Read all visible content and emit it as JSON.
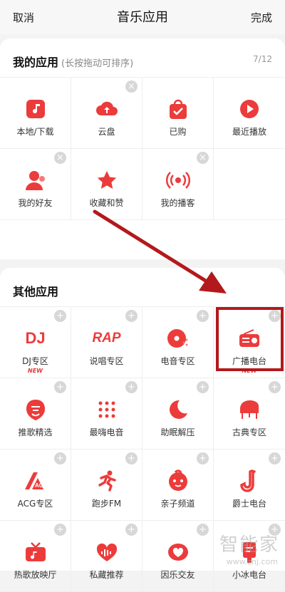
{
  "header": {
    "cancel": "取消",
    "title": "音乐应用",
    "done": "完成"
  },
  "my_apps": {
    "title": "我的应用",
    "hint": "(长按拖动可排序)",
    "count": "7/12",
    "items": [
      {
        "label": "本地/下载",
        "icon": "music-note-icon",
        "removable": false
      },
      {
        "label": "云盘",
        "icon": "cloud-upload-icon",
        "removable": true
      },
      {
        "label": "已购",
        "icon": "shopping-bag-check-icon",
        "removable": false
      },
      {
        "label": "最近播放",
        "icon": "play-icon",
        "removable": false
      },
      {
        "label": "我的好友",
        "icon": "friend-icon",
        "removable": true
      },
      {
        "label": "收藏和赞",
        "icon": "star-icon",
        "removable": false
      },
      {
        "label": "我的播客",
        "icon": "podcast-icon",
        "removable": true
      }
    ]
  },
  "other_apps": {
    "title": "其他应用",
    "items": [
      {
        "label": "DJ专区",
        "icon": "dj-icon",
        "icon_text": "DJ",
        "new": "NEW"
      },
      {
        "label": "说唱专区",
        "icon": "rap-icon",
        "icon_text": "RAP",
        "new": ""
      },
      {
        "label": "电音专区",
        "icon": "disc-icon",
        "new": ""
      },
      {
        "label": "广播电台",
        "icon": "radio-icon",
        "new": "NEW"
      },
      {
        "label": "推歌精选",
        "icon": "recommend-icon",
        "new": ""
      },
      {
        "label": "最嗨电音",
        "icon": "dots-grid-icon",
        "new": ""
      },
      {
        "label": "助眠解压",
        "icon": "moon-icon",
        "new": ""
      },
      {
        "label": "古典专区",
        "icon": "piano-icon",
        "new": ""
      },
      {
        "label": "ACG专区",
        "icon": "acg-icon",
        "icon_text": "ACG",
        "new": ""
      },
      {
        "label": "跑步FM",
        "icon": "runner-icon",
        "new": ""
      },
      {
        "label": "亲子频道",
        "icon": "baby-face-icon",
        "new": ""
      },
      {
        "label": "爵士电台",
        "icon": "saxophone-icon",
        "new": ""
      },
      {
        "label": "热歌放映厅",
        "icon": "tv-icon",
        "new": ""
      },
      {
        "label": "私藏推荐",
        "icon": "heart-wave-icon",
        "new": ""
      },
      {
        "label": "因乐交友",
        "icon": "heart-bubble-icon",
        "new": ""
      },
      {
        "label": "小冰电台",
        "icon": "xiaobing-icon",
        "new": ""
      }
    ]
  },
  "watermark": {
    "text": "智能家",
    "url": "www.znj.com"
  },
  "colors": {
    "accent": "#ec3b3b",
    "highlight": "#b3191c"
  }
}
